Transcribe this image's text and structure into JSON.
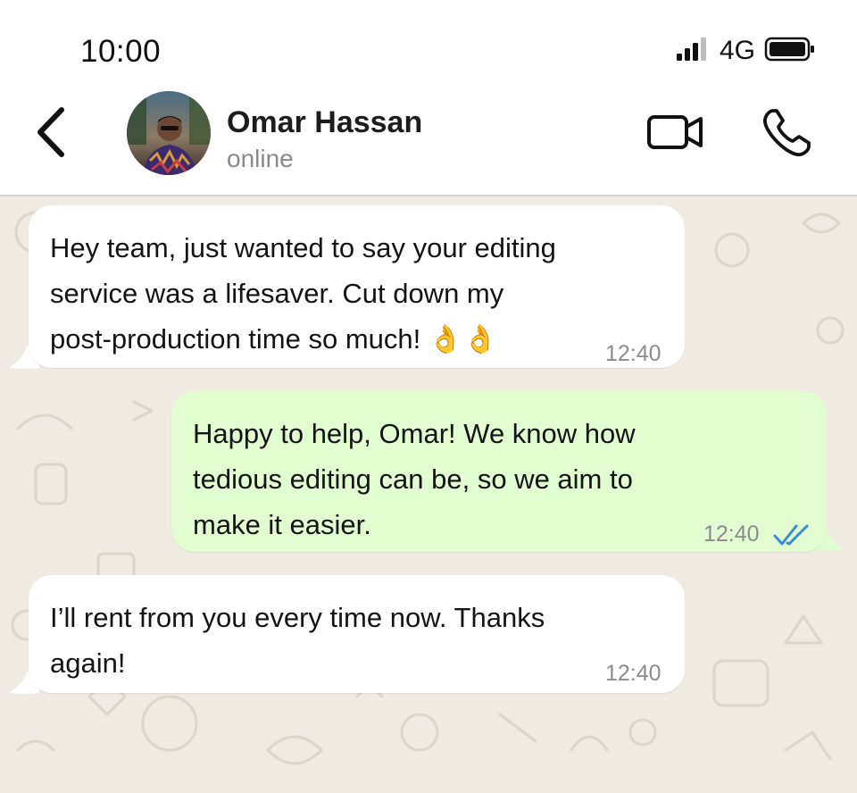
{
  "status_bar": {
    "time": "10:00",
    "network": "4G"
  },
  "header": {
    "contact_name": "Omar Hassan",
    "contact_status": "online"
  },
  "messages": [
    {
      "direction": "incoming",
      "text": "Hey team, just wanted to say your editing\nservice was a lifesaver. Cut down my\npost-production time so much! 👌👌",
      "time": "12:40"
    },
    {
      "direction": "outgoing",
      "text": "Happy to help, Omar! We know how\ntedious editing can be, so we aim to\nmake it easier.",
      "time": "12:40",
      "read": true
    },
    {
      "direction": "incoming",
      "text": "I’ll rent from you every time now. Thanks\nagain!",
      "time": "12:40"
    }
  ],
  "colors": {
    "chat_background": "#efeae2",
    "incoming_bubble": "#ffffff",
    "outgoing_bubble": "#e1fdd0",
    "read_tick": "#3d8bd6"
  }
}
